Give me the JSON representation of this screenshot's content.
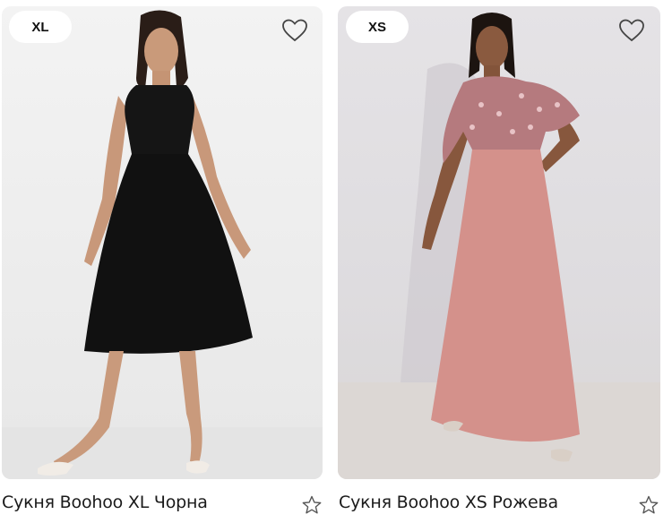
{
  "products": [
    {
      "size": "XL",
      "title": "Сукня Boohoo XL Чорна",
      "dress_color": "#151515",
      "background_color": "#efefef"
    },
    {
      "size": "XS",
      "title": "Сукня Boohoo XS Рожева",
      "dress_color": "#d48e88",
      "background_color": "#e2e0e3"
    }
  ],
  "icons": {
    "favorite": "heart-icon",
    "rate": "star-icon"
  }
}
